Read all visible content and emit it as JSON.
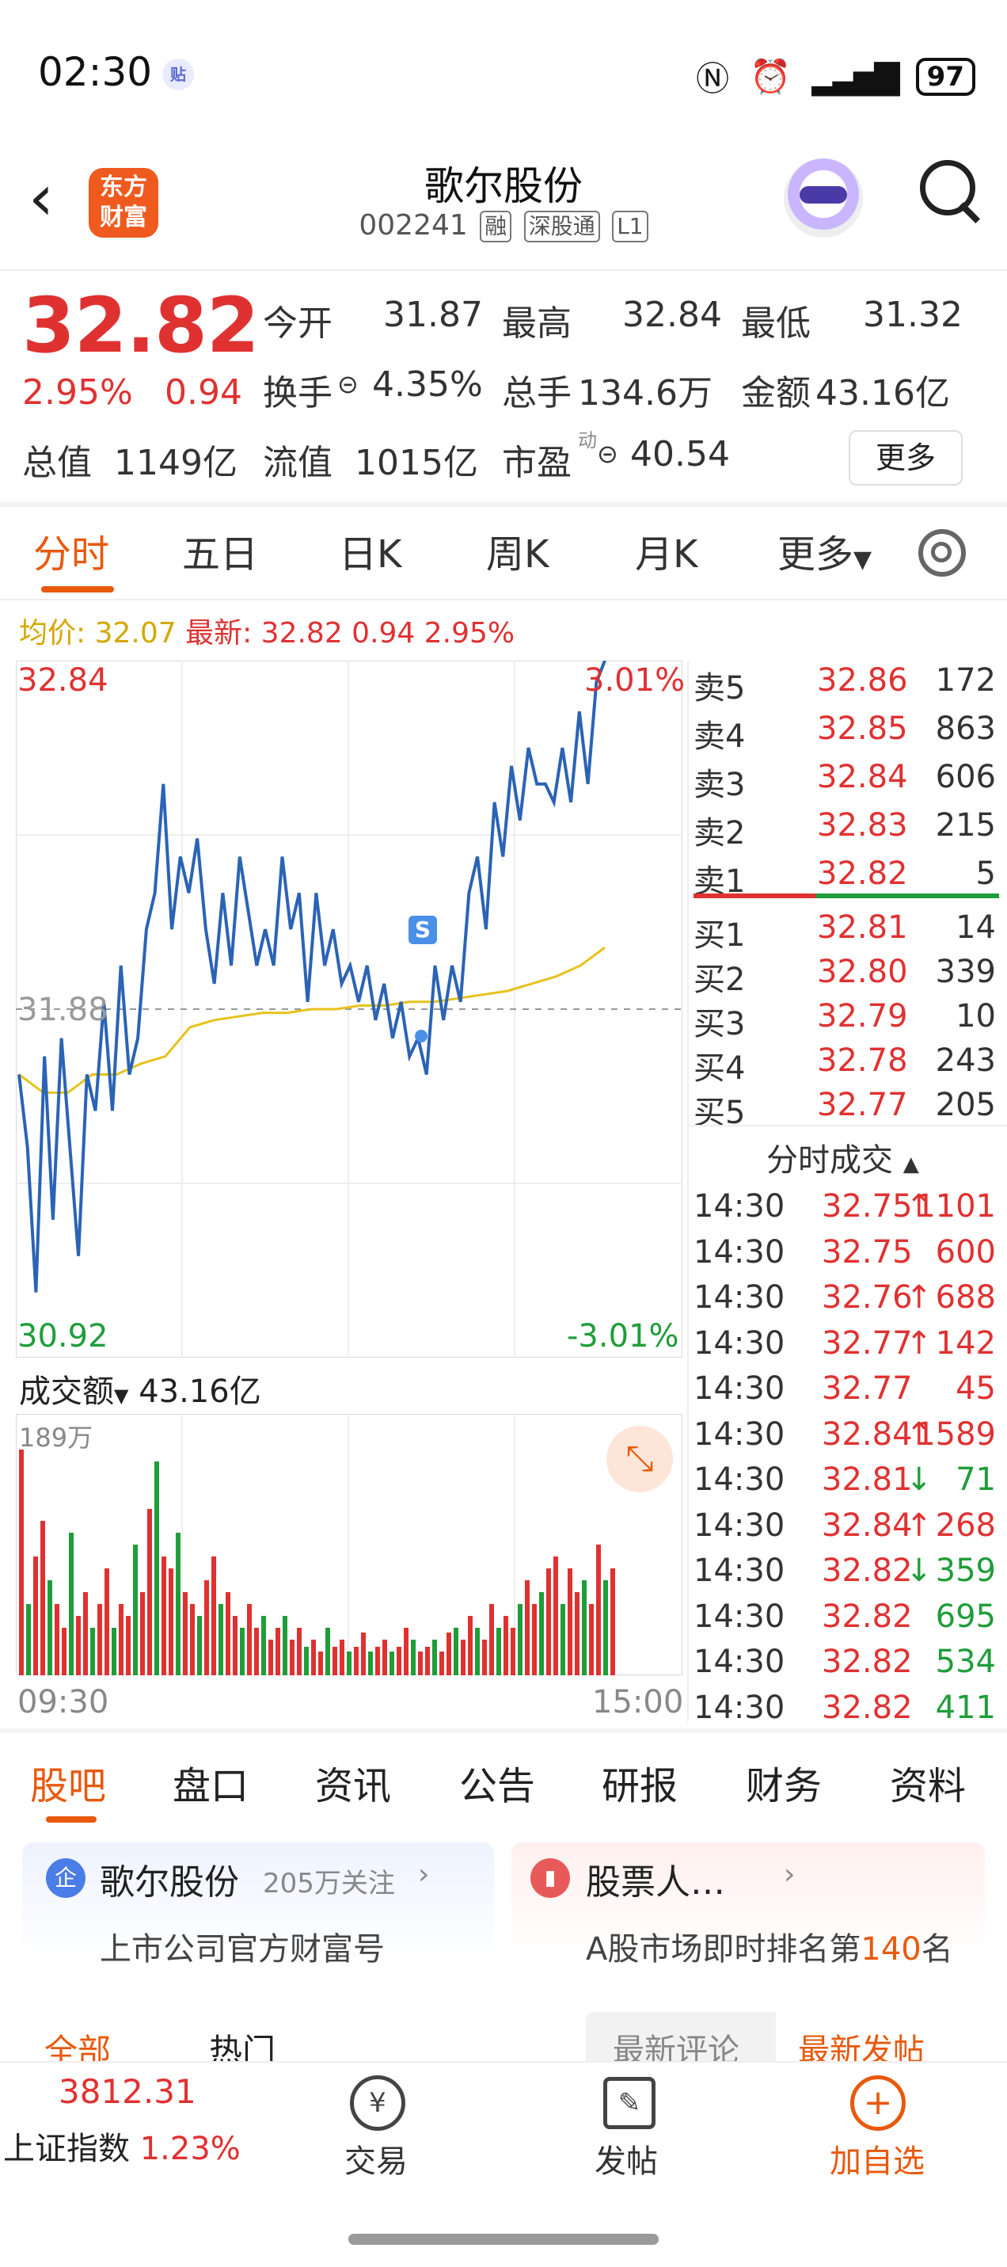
{
  "status_bar": {
    "time": "02:30",
    "badge": "贴",
    "battery": "97"
  },
  "header": {
    "logo": "东方财富",
    "title": "歌尔股份",
    "code": "002241",
    "tags": [
      "融",
      "深股通",
      "L1"
    ]
  },
  "quote": {
    "price": "32.82",
    "pct": "2.95%",
    "change": "0.94",
    "items": [
      {
        "label": "今开",
        "value": "31.87",
        "color": "green"
      },
      {
        "label": "最高",
        "value": "32.84",
        "color": "red"
      },
      {
        "label": "最低",
        "value": "31.32",
        "color": "green"
      },
      {
        "label": "换手",
        "value": "4.35%",
        "color": "normal"
      },
      {
        "label": "总手",
        "value": "134.6万",
        "color": "normal"
      },
      {
        "label": "金额",
        "value": "43.16亿",
        "color": "normal"
      },
      {
        "label": "总值",
        "value": "1149亿",
        "color": "normal"
      },
      {
        "label": "流值",
        "value": "1015亿",
        "color": "normal"
      },
      {
        "label": "市盈",
        "value": "40.54",
        "color": "normal"
      }
    ],
    "pe_sup": "动",
    "more_label": "更多"
  },
  "tabs": [
    "分时",
    "五日",
    "日K",
    "周K",
    "月K",
    "更多"
  ],
  "active_tab": "分时",
  "avg_info": {
    "avg_label": "均价: 32.07",
    "latest_label": "最新: 32.82 0.94 2.95%"
  },
  "chart": {
    "price_high": "32.84",
    "price_low": "30.92",
    "pct_high": "3.01%",
    "pct_low": "-3.01%",
    "ref_price": "31.88",
    "volume_label": "成交额",
    "volume_total": "43.16亿",
    "volume_max": "189万",
    "time_start": "09:30",
    "time_end": "15:00",
    "marker": "S"
  },
  "chart_data": {
    "type": "line",
    "title": "",
    "xlabel": "",
    "ylabel": "",
    "ylim": [
      30.92,
      32.84
    ],
    "x_ticks": [
      "09:30",
      "15:00"
    ],
    "series": [
      {
        "values": [
          31.7,
          31.5,
          31.1,
          31.75,
          31.3,
          31.8,
          31.5,
          31.2,
          31.7,
          31.6,
          31.9,
          31.6,
          32.0,
          31.7,
          31.8,
          32.1,
          32.2,
          32.5,
          32.1,
          32.3,
          32.2,
          32.35,
          32.1,
          31.95,
          32.2,
          32.0,
          32.3,
          32.15,
          32.0,
          32.1,
          32.0,
          32.3,
          32.1,
          32.2,
          31.9,
          32.2,
          32.0,
          32.1,
          31.95,
          32.0,
          31.9,
          32.0,
          31.85,
          31.95,
          31.8,
          31.9,
          31.75,
          31.8,
          31.7,
          32.0,
          31.85,
          32.0,
          31.9,
          32.2,
          32.3,
          32.1,
          32.45,
          32.3,
          32.55,
          32.4,
          32.6,
          32.5,
          32.5,
          32.45,
          32.6,
          32.45,
          32.7,
          32.5,
          32.78,
          32.84
        ],
        "color": "#2b63b5"
      },
      {
        "values": [
          31.7,
          31.65,
          31.65,
          31.7,
          31.7,
          31.73,
          31.75,
          31.83,
          31.85,
          31.86,
          31.87,
          31.87,
          31.88,
          31.88,
          31.89,
          31.89,
          31.9,
          31.9,
          31.91,
          31.92,
          31.93,
          31.95,
          31.97,
          32.0,
          32.05
        ],
        "color": "#e8c21b"
      }
    ]
  },
  "order_book": {
    "sell": [
      {
        "label": "卖5",
        "price": "32.86",
        "vol": "172"
      },
      {
        "label": "卖4",
        "price": "32.85",
        "vol": "863"
      },
      {
        "label": "卖3",
        "price": "32.84",
        "vol": "606"
      },
      {
        "label": "卖2",
        "price": "32.83",
        "vol": "215"
      },
      {
        "label": "卖1",
        "price": "32.82",
        "vol": "5"
      }
    ],
    "buy": [
      {
        "label": "买1",
        "price": "32.81",
        "vol": "14"
      },
      {
        "label": "买2",
        "price": "32.80",
        "vol": "339"
      },
      {
        "label": "买3",
        "price": "32.79",
        "vol": "10"
      },
      {
        "label": "买4",
        "price": "32.78",
        "vol": "243"
      },
      {
        "label": "买5",
        "price": "32.77",
        "vol": "205"
      }
    ],
    "trades_title": "分时成交",
    "trades": [
      {
        "time": "14:30",
        "price": "32.75",
        "dir": "↑",
        "vol": "1101",
        "color": "red"
      },
      {
        "time": "14:30",
        "price": "32.75",
        "dir": "",
        "vol": "600",
        "color": "red"
      },
      {
        "time": "14:30",
        "price": "32.76",
        "dir": "↑",
        "vol": "688",
        "color": "red"
      },
      {
        "time": "14:30",
        "price": "32.77",
        "dir": "↑",
        "vol": "142",
        "color": "red"
      },
      {
        "time": "14:30",
        "price": "32.77",
        "dir": "",
        "vol": "45",
        "color": "red"
      },
      {
        "time": "14:30",
        "price": "32.84",
        "dir": "↑",
        "vol": "1589",
        "color": "red"
      },
      {
        "time": "14:30",
        "price": "32.81",
        "dir": "↓",
        "vol": "71",
        "color": "green"
      },
      {
        "time": "14:30",
        "price": "32.84",
        "dir": "↑",
        "vol": "268",
        "color": "red"
      },
      {
        "time": "14:30",
        "price": "32.82",
        "dir": "↓",
        "vol": "359",
        "color": "green"
      },
      {
        "time": "14:30",
        "price": "32.82",
        "dir": "",
        "vol": "695",
        "color": "green"
      },
      {
        "time": "14:30",
        "price": "32.82",
        "dir": "",
        "vol": "534",
        "color": "green"
      },
      {
        "time": "14:30",
        "price": "32.82",
        "dir": "",
        "vol": "411",
        "color": "green"
      }
    ]
  },
  "bottom_tabs": [
    "股吧",
    "盘口",
    "资讯",
    "公告",
    "研报",
    "财务",
    "资料"
  ],
  "cards": {
    "left": {
      "icon": "企",
      "name": "歌尔股份",
      "follow": "205万关注",
      "desc": "上市公司官方财富号"
    },
    "right": {
      "name": "股票人…",
      "desc_prefix": "A股市场即时排名第",
      "rank": "140",
      "desc_suffix": "名"
    }
  },
  "filters": {
    "all": "全部",
    "hot": "热门",
    "latest_comment": "最新评论",
    "latest_post": "最新发帖"
  },
  "bottom_nav": {
    "index_value": "3812.31",
    "index_name": "上证指数",
    "index_pct": "1.23%",
    "trade": "交易",
    "post": "发帖",
    "add_watch": "加自选",
    "trade_icon": "¥"
  },
  "colors": {
    "red": "#e03131",
    "green": "#1f9d3a",
    "accent": "#e8590c",
    "price_line": "#2b63b5",
    "avg_line": "#e8c21b"
  }
}
